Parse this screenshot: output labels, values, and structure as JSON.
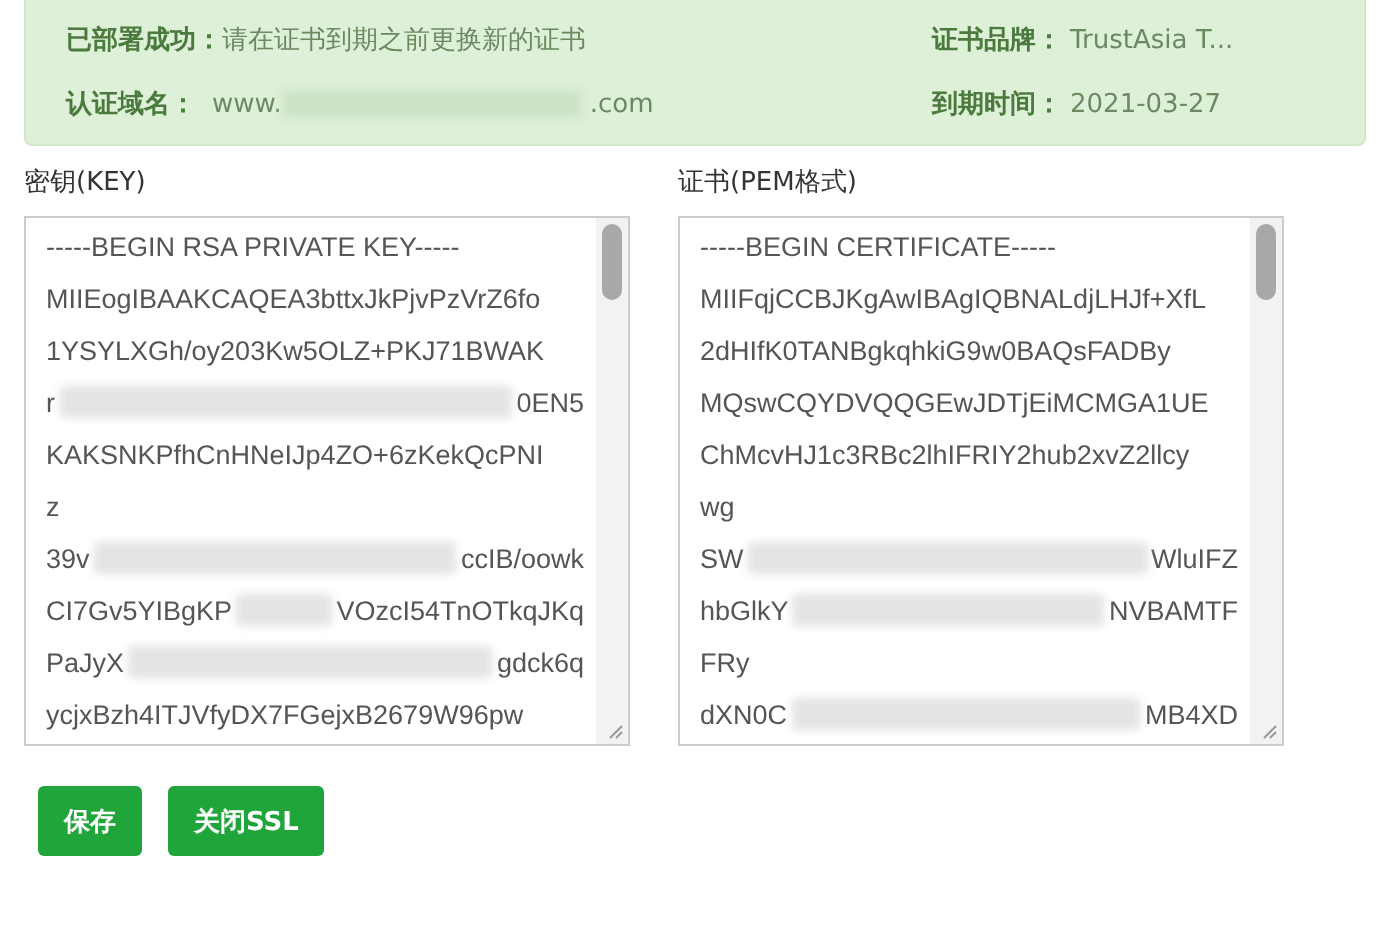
{
  "notice": {
    "rows": [
      {
        "label": "已部署成功：",
        "value": [
          "请在证书到期之前更换新的证书"
        ],
        "side_label": "证书品牌：",
        "side_value": "TrustAsia T..."
      },
      {
        "label": "认证域名：",
        "value": [
          "www.",
          ".com"
        ],
        "side_label": "到期时间：",
        "side_value": "2021-03-27"
      }
    ]
  },
  "editors": [
    {
      "label": "密钥(KEY)",
      "lines": [
        {
          "parts": [
            "-----BEGIN RSA PRIVATE KEY-----"
          ]
        },
        {
          "parts": [
            "MIIEogIBAAKCAQEA3bttxJkPjvPzVrZ6fo"
          ]
        },
        {
          "parts": [
            "1YSYLXGh/oy203Kw5OLZ+PKJ71BWAK"
          ]
        },
        {
          "parts": [
            "r",
            "0EN5"
          ]
        },
        {
          "parts": [
            "KAKSNKPfhCnHNeIJp4ZO+6zKekQcPNI"
          ]
        },
        {
          "parts": [
            "z"
          ]
        },
        {
          "parts": [
            "39v",
            "ccIB/oowk"
          ]
        },
        {
          "parts": [
            "CI7Gv5YIBgKP",
            "VOzcI54TnOTkqJKq"
          ]
        },
        {
          "parts": [
            "PaJyX",
            "gdck6q"
          ]
        },
        {
          "parts": [
            "ycjxBzh4ITJVfyDX7FGejxB2679W96pw"
          ]
        }
      ]
    },
    {
      "label": "证书(PEM格式)",
      "lines": [
        {
          "parts": [
            "-----BEGIN CERTIFICATE-----"
          ]
        },
        {
          "parts": [
            "MIIFqjCCBJKgAwIBAgIQBNALdjLHJf+XfL"
          ]
        },
        {
          "parts": [
            "2dHIfK0TANBgkqhkiG9w0BAQsFADBy"
          ]
        },
        {
          "parts": [
            "MQswCQYDVQQGEwJDTjEiMCMGA1UE"
          ]
        },
        {
          "parts": [
            "ChMcvHJ1c3RBc2lhIFRIY2hub2xvZ2llcy"
          ]
        },
        {
          "parts": [
            "wg"
          ]
        },
        {
          "parts": [
            "SW",
            "WluIFZ"
          ]
        },
        {
          "parts": [
            "hbGlkY",
            "NVBAMTF"
          ]
        },
        {
          "parts": [
            "FRy"
          ]
        },
        {
          "parts": [
            "dXN0C",
            "MB4XD"
          ]
        }
      ]
    }
  ],
  "buttons": [
    "保存",
    "关闭SSL"
  ]
}
